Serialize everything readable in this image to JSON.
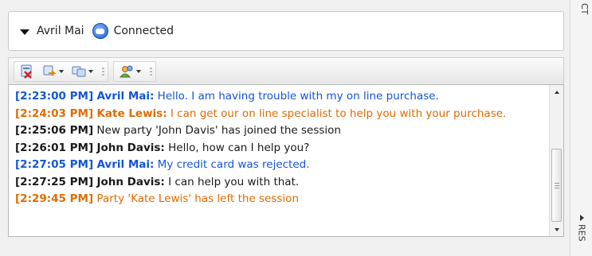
{
  "party": {
    "name": "Avril Mai",
    "status": "Connected"
  },
  "toolbar": {
    "buttons": [
      {
        "icon": "end-session-icon"
      },
      {
        "icon": "transfer-icon"
      },
      {
        "icon": "conference-icon"
      },
      {
        "icon": "consult-icon"
      }
    ]
  },
  "transcript": {
    "lines": [
      {
        "time": "[2:23:00 PM]",
        "name": "Avril Mai:",
        "text": " Hello. I am having trouble with my on line purchase.",
        "color": "#1456d6"
      },
      {
        "time": "[2:24:03 PM]",
        "name": "Kate Lewis:",
        "text": " I can get our on line specialist to help you with your purchase.",
        "color": "#e06b00"
      },
      {
        "time": "[2:25:06 PM]",
        "name": "",
        "text": " New party 'John Davis' has joined the session",
        "color": "#1a1a1a"
      },
      {
        "time": "[2:26:01 PM]",
        "name": "John Davis:",
        "text": " Hello, how can I help you?",
        "color": "#1a1a1a"
      },
      {
        "time": "[2:27:05 PM]",
        "name": "Avril Mai:",
        "text": " My credit card was rejected.",
        "color": "#1456d6"
      },
      {
        "time": "[2:27:25 PM]",
        "name": "John Davis:",
        "text": " I can help you with that.",
        "color": "#1a1a1a"
      },
      {
        "time": "[2:29:45 PM]",
        "name": "",
        "text": " Party 'Kate Lewis' has left the session",
        "color": "#e06b00"
      }
    ]
  },
  "side": {
    "top_label": "CT",
    "bottom_label": "RES"
  }
}
